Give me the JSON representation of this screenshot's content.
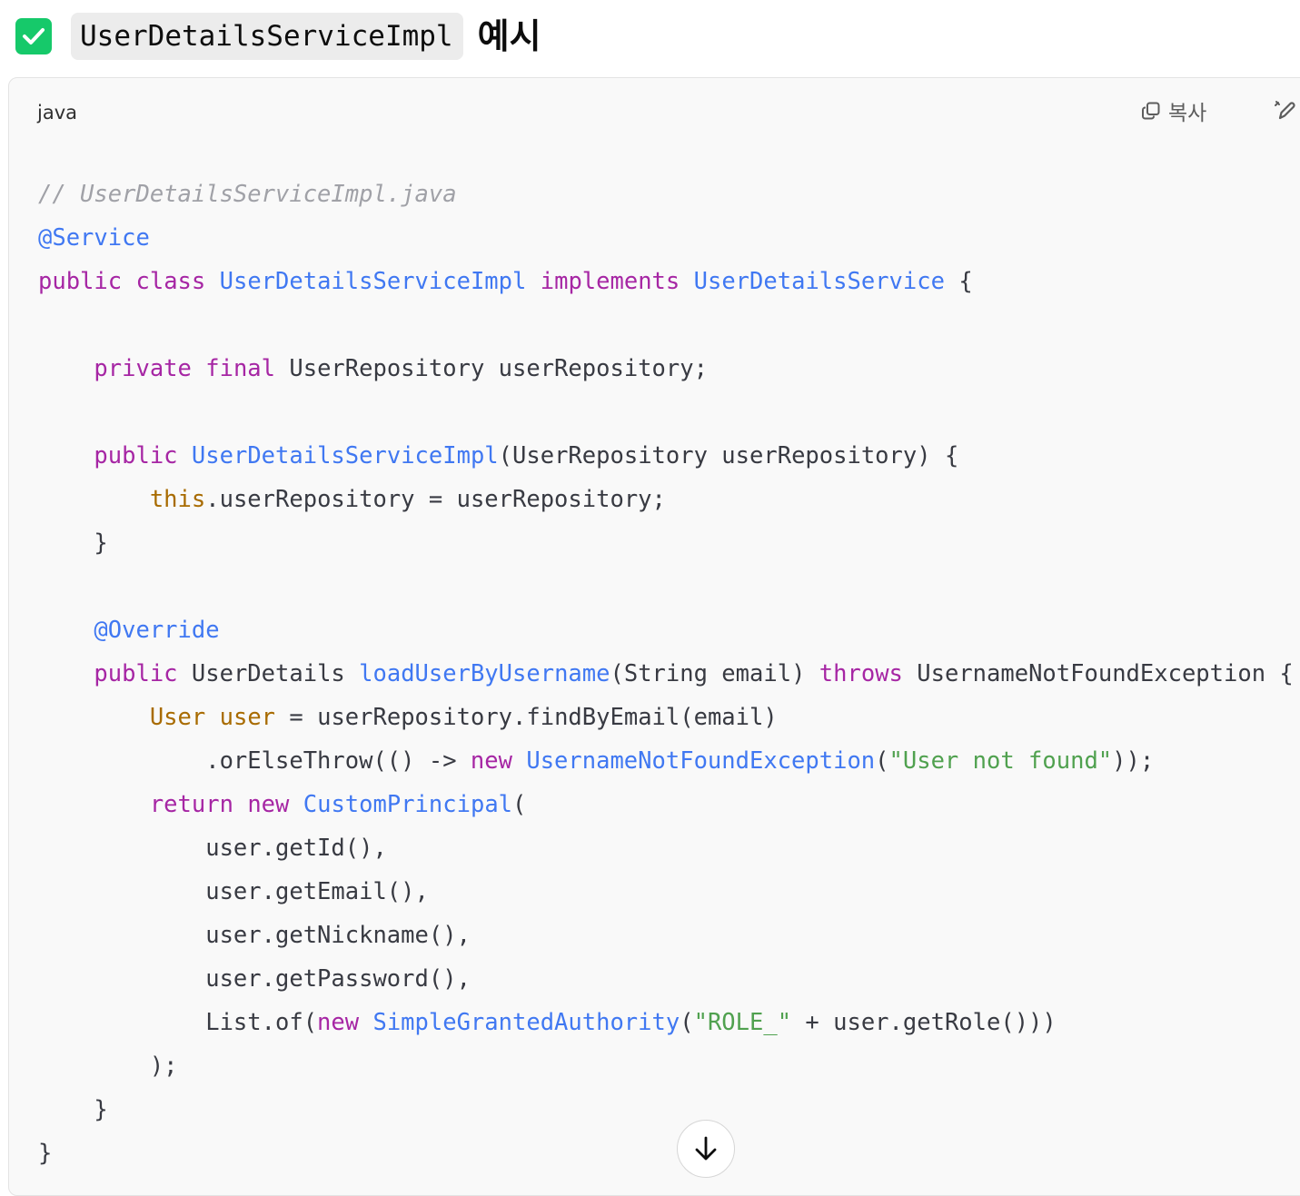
{
  "heading": {
    "code_name": "UserDetailsServiceImpl",
    "suffix": "예시"
  },
  "code_block": {
    "language": "java",
    "copy_label": "복사",
    "lines": [
      [
        {
          "t": "// UserDetailsServiceImpl.java",
          "c": "cmt"
        }
      ],
      [
        {
          "t": "@Service",
          "c": "ty"
        }
      ],
      [
        {
          "t": "public",
          "c": "kw"
        },
        {
          "t": " "
        },
        {
          "t": "class",
          "c": "kw"
        },
        {
          "t": " "
        },
        {
          "t": "UserDetailsServiceImpl",
          "c": "ty"
        },
        {
          "t": " "
        },
        {
          "t": "implements",
          "c": "kw"
        },
        {
          "t": " "
        },
        {
          "t": "UserDetailsService",
          "c": "ty"
        },
        {
          "t": " {"
        }
      ],
      [],
      [
        {
          "t": "    "
        },
        {
          "t": "private",
          "c": "kw"
        },
        {
          "t": " "
        },
        {
          "t": "final",
          "c": "kw"
        },
        {
          "t": " UserRepository userRepository;"
        }
      ],
      [],
      [
        {
          "t": "    "
        },
        {
          "t": "public",
          "c": "kw"
        },
        {
          "t": " "
        },
        {
          "t": "UserDetailsServiceImpl",
          "c": "ty"
        },
        {
          "t": "(UserRepository userRepository) {"
        }
      ],
      [
        {
          "t": "        "
        },
        {
          "t": "this",
          "c": "th"
        },
        {
          "t": ".userRepository = userRepository;"
        }
      ],
      [
        {
          "t": "    }"
        }
      ],
      [],
      [
        {
          "t": "    "
        },
        {
          "t": "@Override",
          "c": "ty"
        }
      ],
      [
        {
          "t": "    "
        },
        {
          "t": "public",
          "c": "kw"
        },
        {
          "t": " UserDetails "
        },
        {
          "t": "loadUserByUsername",
          "c": "ty"
        },
        {
          "t": "(String email) "
        },
        {
          "t": "throws",
          "c": "kw"
        },
        {
          "t": " UsernameNotFoundException {"
        }
      ],
      [
        {
          "t": "        "
        },
        {
          "t": "User",
          "c": "th"
        },
        {
          "t": " "
        },
        {
          "t": "user",
          "c": "th"
        },
        {
          "t": " = userRepository.findByEmail(email)"
        }
      ],
      [
        {
          "t": "            .orElseThrow(() -> "
        },
        {
          "t": "new",
          "c": "kw"
        },
        {
          "t": " "
        },
        {
          "t": "UsernameNotFoundException",
          "c": "ty"
        },
        {
          "t": "("
        },
        {
          "t": "\"User not found\"",
          "c": "str"
        },
        {
          "t": "));"
        }
      ],
      [
        {
          "t": "        "
        },
        {
          "t": "return",
          "c": "kw"
        },
        {
          "t": " "
        },
        {
          "t": "new",
          "c": "kw"
        },
        {
          "t": " "
        },
        {
          "t": "CustomPrincipal",
          "c": "ty"
        },
        {
          "t": "("
        }
      ],
      [
        {
          "t": "            user.getId(),"
        }
      ],
      [
        {
          "t": "            user.getEmail(),"
        }
      ],
      [
        {
          "t": "            user.getNickname(),"
        }
      ],
      [
        {
          "t": "            user.getPassword(),"
        }
      ],
      [
        {
          "t": "            List.of("
        },
        {
          "t": "new",
          "c": "kw"
        },
        {
          "t": " "
        },
        {
          "t": "SimpleGrantedAuthority",
          "c": "ty"
        },
        {
          "t": "("
        },
        {
          "t": "\"ROLE_\"",
          "c": "str"
        },
        {
          "t": " + user.getRole()))"
        }
      ],
      [
        {
          "t": "        );"
        }
      ],
      [
        {
          "t": "    }"
        }
      ],
      [
        {
          "t": "}"
        }
      ]
    ]
  },
  "icons": {
    "check": "check-icon",
    "copy": "copy-icon",
    "edit": "edit-icon",
    "scroll": "arrow-down-icon"
  },
  "colors": {
    "check_bg": "#16c96a",
    "keyword": "#a626a4",
    "type": "#4078f2",
    "string": "#50a14f",
    "this": "#a86b00",
    "comment": "#a0a1a7"
  }
}
